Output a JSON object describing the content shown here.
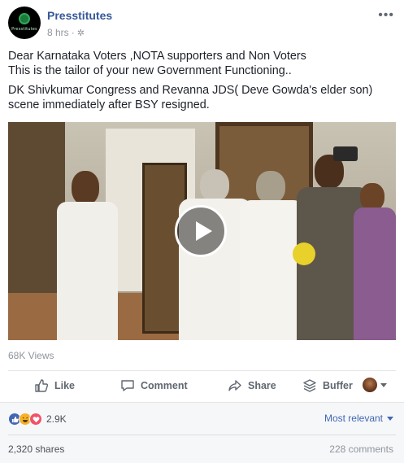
{
  "post": {
    "page_name": "Presstitutes",
    "avatar_text": "Presstitutes",
    "time": "8 hrs",
    "privacy_icon": "gear-icon",
    "more_icon": "more-dots-icon",
    "lines": [
      "Dear Karnataka Voters ,NOTA supporters and Non Voters",
      "This is the tailor of your new Government Functioning..",
      "DK Shivkumar Congress and Revanna JDS( Deve Gowda's elder son)",
      "scene immediately after BSY resigned."
    ],
    "views": "68K Views"
  },
  "actions": {
    "like": "Like",
    "comment": "Comment",
    "share": "Share",
    "buffer": "Buffer"
  },
  "reactions": {
    "count": "2.9K",
    "types": [
      "like",
      "haha",
      "love"
    ],
    "sort_label": "Most relevant",
    "shares": "2,320 shares",
    "comments": "228 comments"
  },
  "colors": {
    "link": "#365899",
    "accent": "#4267b2",
    "muted": "#90949c",
    "love": "#f25268",
    "haha": "#f7b125"
  }
}
